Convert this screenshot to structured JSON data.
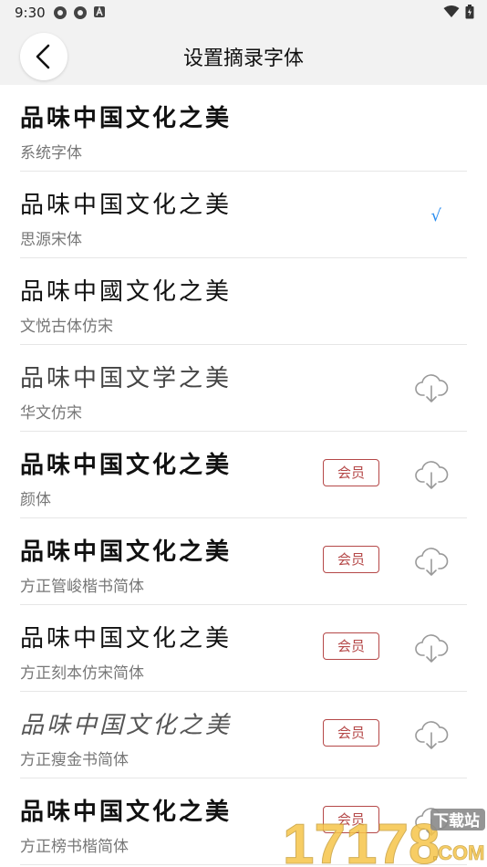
{
  "status": {
    "time": "9:30"
  },
  "header": {
    "title": "设置摘录字体"
  },
  "fonts": [
    {
      "sample": "品味中国文化之美",
      "name": "系统字体",
      "selected": false,
      "vip": false,
      "download": false
    },
    {
      "sample": "品味中国文化之美",
      "name": "思源宋体",
      "selected": true,
      "vip": false,
      "download": false
    },
    {
      "sample": "品味中國文化之美",
      "name": "文悦古体仿宋",
      "selected": false,
      "vip": false,
      "download": false
    },
    {
      "sample": "品味中国文学之美",
      "name": "华文仿宋",
      "selected": false,
      "vip": false,
      "download": true
    },
    {
      "sample": "品味中国文化之美",
      "name": "颜体",
      "selected": false,
      "vip": true,
      "download": true
    },
    {
      "sample": "品味中国文化之美",
      "name": "方正管峻楷书简体",
      "selected": false,
      "vip": true,
      "download": true
    },
    {
      "sample": "品味中国文化之美",
      "name": "方正刻本仿宋简体",
      "selected": false,
      "vip": true,
      "download": true
    },
    {
      "sample": "品味中国文化之美",
      "name": "方正瘦金书简体",
      "selected": false,
      "vip": true,
      "download": true
    },
    {
      "sample": "品味中国文化之美",
      "name": "方正榜书楷简体",
      "selected": false,
      "vip": true,
      "download": true
    }
  ],
  "labels": {
    "vip": "会员",
    "check": "√"
  },
  "watermark": {
    "text": "17178",
    "sub": "下载站",
    "domain": ".COM"
  },
  "colors": {
    "accent": "#2b8ef0",
    "vip": "#b54848",
    "header_bg": "#f2f2f2"
  }
}
